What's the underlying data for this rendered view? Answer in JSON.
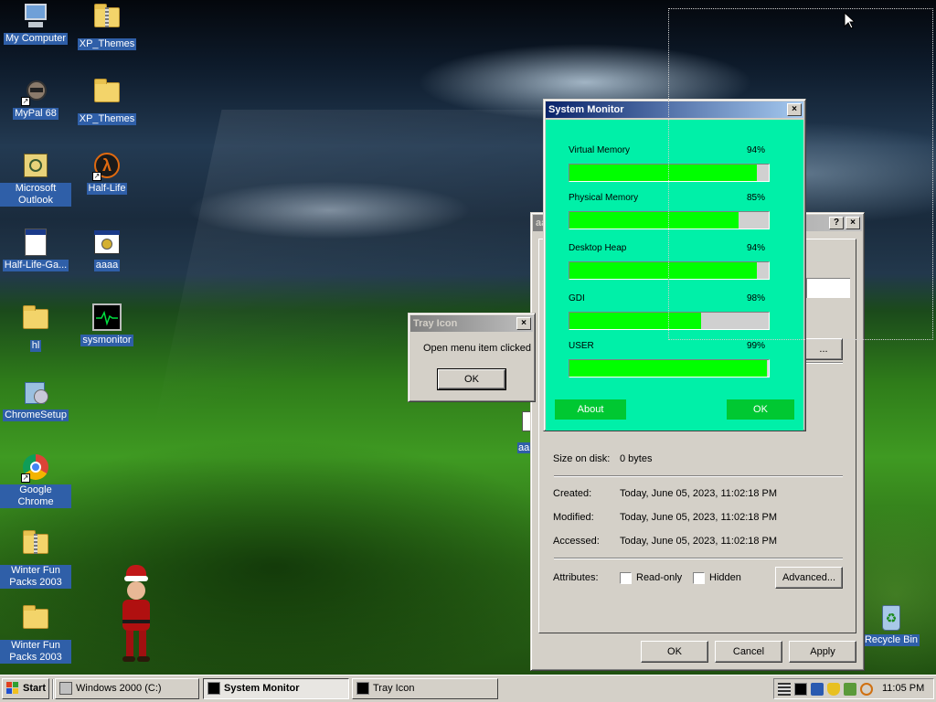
{
  "desktop": {
    "icons": [
      {
        "label": "My Computer"
      },
      {
        "label": "XP_Themes"
      },
      {
        "label": "MyPal 68"
      },
      {
        "label": "XP_Themes"
      },
      {
        "label": "Microsoft Outlook"
      },
      {
        "label": "Half-Life"
      },
      {
        "label": "Half-Life-Ga..."
      },
      {
        "label": "aaaa"
      },
      {
        "label": "hl"
      },
      {
        "label": "sysmonitor"
      },
      {
        "label": "ChromeSetup"
      },
      {
        "label": "Google Chrome"
      },
      {
        "label": "Winter Fun Packs 2003"
      },
      {
        "label": "Winter Fun Packs 2003"
      },
      {
        "label": "Recycle Bin"
      }
    ],
    "partial_icon_label": "aa"
  },
  "properties_window": {
    "title": "aa",
    "help_btn": "?",
    "close_btn": "×",
    "size_on_disk_label": "Size on disk:",
    "size_on_disk_value": "0 bytes",
    "created_label": "Created:",
    "created_value": "Today, June 05, 2023, 11:02:18 PM",
    "modified_label": "Modified:",
    "modified_value": "Today, June 05, 2023, 11:02:18 PM",
    "accessed_label": "Accessed:",
    "accessed_value": "Today, June 05, 2023, 11:02:18 PM",
    "attributes_label": "Attributes:",
    "readonly_label": "Read-only",
    "hidden_label": "Hidden",
    "advanced_btn": "Advanced...",
    "ok_btn": "OK",
    "cancel_btn": "Cancel",
    "apply_btn": "Apply",
    "change_btn": "..."
  },
  "tray_dialog": {
    "title": "Tray Icon",
    "close_btn": "×",
    "message": "Open menu item clicked",
    "ok_btn": "OK"
  },
  "system_monitor": {
    "title": "System Monitor",
    "close_btn": "×",
    "accent_color": "#00f0a8",
    "bar_color": "#00ff00",
    "gauges": [
      {
        "label": "Virtual Memory",
        "percent_text": "94%",
        "level": 0.94
      },
      {
        "label": "Physical Memory",
        "percent_text": "85%",
        "level": 0.85
      },
      {
        "label": "Desktop Heap",
        "percent_text": "94%",
        "level": 0.94
      },
      {
        "label": "GDI",
        "percent_text": "98%",
        "level": 0.66
      },
      {
        "label": "USER",
        "percent_text": "99%",
        "level": 0.99
      }
    ],
    "about_btn": "About",
    "ok_btn": "OK"
  },
  "taskbar": {
    "start_label": "Start",
    "tasks": [
      {
        "label": "Windows 2000 (C:)",
        "icon": "drive-icon"
      },
      {
        "label": "System Monitor",
        "icon": "monitor-icon"
      },
      {
        "label": "Tray Icon",
        "icon": "monitor-icon"
      }
    ],
    "clock": "11:05 PM"
  }
}
